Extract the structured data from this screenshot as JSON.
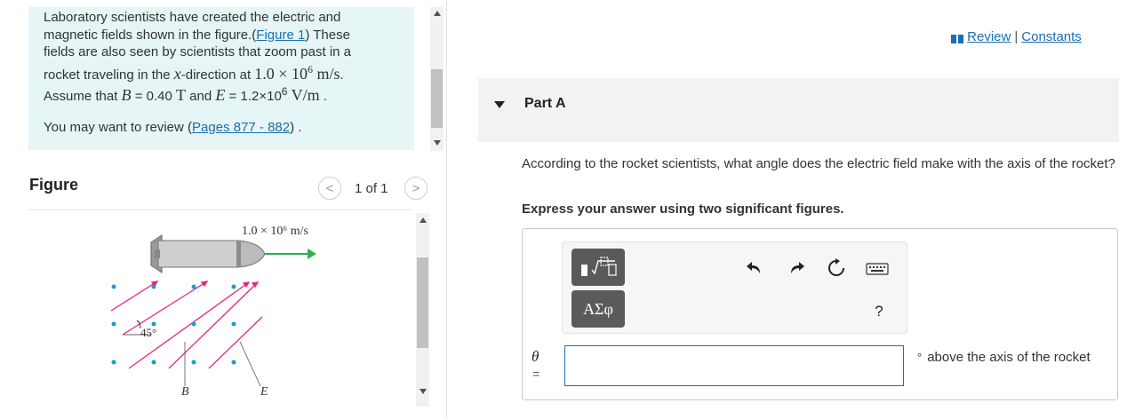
{
  "problem": {
    "line1": "Laboratory scientists have created the electric and",
    "line2_pre": "magnetic fields shown in the figure.(",
    "figure_link": "Figure 1",
    "line2_post": ") These",
    "line3": "fields are also seen by scientists that zoom past in a",
    "line4_pre": "rocket traveling in the ",
    "line4_var": "x",
    "line4_mid": "-direction at ",
    "line4_val": "1.0 × 10",
    "line4_exp": "6",
    "line4_unit": " m/s",
    "line4_end": ".",
    "line5_pre": "Assume that ",
    "line5_B": "B",
    "line5_bval": " = 0.40 ",
    "line5_T": "T",
    "line5_and": " and ",
    "line5_E": "E",
    "line5_eval": " = 1.2×10",
    "line5_exp": "6",
    "line5_unit": " V/m",
    "line5_end": " .",
    "review_pre": "You may want to review (",
    "review_link": "Pages 877 - 882",
    "review_post": ") ."
  },
  "figure": {
    "title": "Figure",
    "pager": "1 of 1",
    "prev_glyph": "<",
    "next_glyph": ">",
    "velocity_label": "1.0 × 10⁶ m/s",
    "angle_label": "45°",
    "b_label": "B",
    "e_label": "E"
  },
  "header": {
    "review": "Review",
    "separator": "|",
    "constants": "Constants"
  },
  "part": {
    "label": "Part A",
    "question": "According to the rocket scientists, what angle does the electric field make with the axis of the rocket?",
    "instruction": "Express your answer using two significant figures."
  },
  "toolbar": {
    "greek_label": "ΑΣφ",
    "help_label": "?",
    "templates_icon": "templates-icon",
    "undo_icon": "undo-icon",
    "redo_icon": "redo-icon",
    "reset_icon": "reset-icon",
    "keyboard_icon": "keyboard-icon"
  },
  "answer": {
    "variable": "θ",
    "equals": "=",
    "value": "",
    "degree_symbol": "°",
    "unit_text": "above the axis of the rocket"
  },
  "colors": {
    "link": "#1a6fb0",
    "panel": "#e6f5f5",
    "e_field": "#e8257a",
    "b_dot": "#1f9ad6",
    "velocity_arrow": "#2bb24c"
  }
}
